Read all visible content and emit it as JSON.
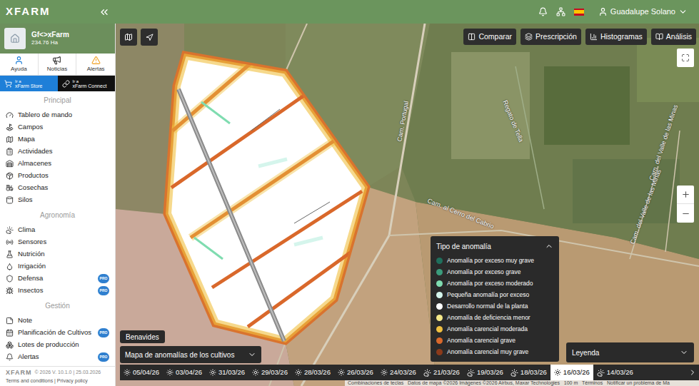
{
  "header": {
    "logo": "XFARM",
    "user": "Guadalupe Solano"
  },
  "farm": {
    "name": "Gf<>xFarm",
    "area": "234.76 Ha"
  },
  "quick_links": [
    {
      "label": "Ayuda",
      "color": "#1e7fd8"
    },
    {
      "label": "Noticias",
      "color": "#333333"
    },
    {
      "label": "Alertas",
      "color": "#f0a020"
    }
  ],
  "store_links": [
    {
      "prefix": "Ir a",
      "label": "xFarm Store",
      "color": "#1e7fd8"
    },
    {
      "prefix": "Ir a",
      "label": "xFarm Connect",
      "color": "#111111"
    }
  ],
  "sidebar": {
    "sections": [
      {
        "title": "Principal",
        "items": [
          {
            "label": "Tablero de mando",
            "pro": false
          },
          {
            "label": "Campos",
            "pro": false
          },
          {
            "label": "Mapa",
            "pro": false
          },
          {
            "label": "Actividades",
            "pro": false
          },
          {
            "label": "Almacenes",
            "pro": false
          },
          {
            "label": "Productos",
            "pro": false
          },
          {
            "label": "Cosechas",
            "pro": false
          },
          {
            "label": "Silos",
            "pro": false
          }
        ]
      },
      {
        "title": "Agronomía",
        "items": [
          {
            "label": "Clima",
            "pro": false
          },
          {
            "label": "Sensores",
            "pro": false
          },
          {
            "label": "Nutrición",
            "pro": false
          },
          {
            "label": "Irrigación",
            "pro": false
          },
          {
            "label": "Defensa",
            "pro": true
          },
          {
            "label": "Insectos",
            "pro": true
          }
        ]
      },
      {
        "title": "Gestión",
        "items": [
          {
            "label": "Note",
            "pro": false
          },
          {
            "label": "Planificación de Cultivos",
            "pro": true
          },
          {
            "label": "Lotes de producción",
            "pro": false
          },
          {
            "label": "Alertas",
            "pro": true
          }
        ]
      }
    ]
  },
  "pro_label": "PRO",
  "footer": {
    "logo": "XFARM",
    "version": "© 2026 V. 10.1.0 | 25.03.2026",
    "links": "Terms and conditions | Privacy policy"
  },
  "map": {
    "toolbar": [
      "Comparar",
      "Prescripción",
      "Histogramas",
      "Análisis"
    ],
    "labels": [
      "Cam. Portugal",
      "Regato de Tella",
      "Cam. al Cerro del Cabrio",
      "Cam. del Valle de las Minas",
      "Cam. del Valle de las Minas"
    ],
    "location": "Benavides",
    "layer": "Mapa de anomalías de los cultivos",
    "legend": {
      "title": "Tipo de anomalía",
      "expanded": true,
      "items": [
        {
          "label": "Anomalía por exceso muy grave",
          "color": "#1f6f5c"
        },
        {
          "label": "Anomalía por exceso grave",
          "color": "#3b9c7c"
        },
        {
          "label": "Anomalía por exceso moderado",
          "color": "#7fdcb0"
        },
        {
          "label": "Pequeña anomalía por exceso",
          "color": "#d5f5ec"
        },
        {
          "label": "Desarrollo normal de la planta",
          "color": "#ffffff"
        },
        {
          "label": "Anomalía de deficiencia menor",
          "color": "#f5e98a"
        },
        {
          "label": "Anomalía carencial moderada",
          "color": "#f0c040"
        },
        {
          "label": "Anomalía carencial grave",
          "color": "#d9682b"
        },
        {
          "label": "Anomalía carencial muy grave",
          "color": "#8b3a1a"
        }
      ]
    },
    "legend_select": "Leyenda",
    "timeline": [
      {
        "date": "05/04/26",
        "kind": "sunny",
        "selected": false
      },
      {
        "date": "03/04/26",
        "kind": "sunny",
        "selected": false
      },
      {
        "date": "31/03/26",
        "kind": "sunny",
        "selected": false
      },
      {
        "date": "29/03/26",
        "kind": "sunny",
        "selected": false
      },
      {
        "date": "28/03/26",
        "kind": "sunny",
        "selected": false
      },
      {
        "date": "26/03/26",
        "kind": "sunny",
        "selected": false
      },
      {
        "date": "24/03/26",
        "kind": "sunny",
        "selected": false
      },
      {
        "date": "21/03/26",
        "kind": "cloudy",
        "selected": false
      },
      {
        "date": "19/03/26",
        "kind": "cloudy",
        "selected": false
      },
      {
        "date": "18/03/26",
        "kind": "cloudy",
        "selected": false
      },
      {
        "date": "16/03/26",
        "kind": "sunny",
        "selected": true
      },
      {
        "date": "14/03/26",
        "kind": "cloudy",
        "selected": false
      }
    ],
    "attribution": "Combinaciones de teclas   Datos de mapa ©2026 Imágenes ©2026 Airbus, Maxar Technologies   100 m   Términos   Notificar un problema de Ma"
  }
}
